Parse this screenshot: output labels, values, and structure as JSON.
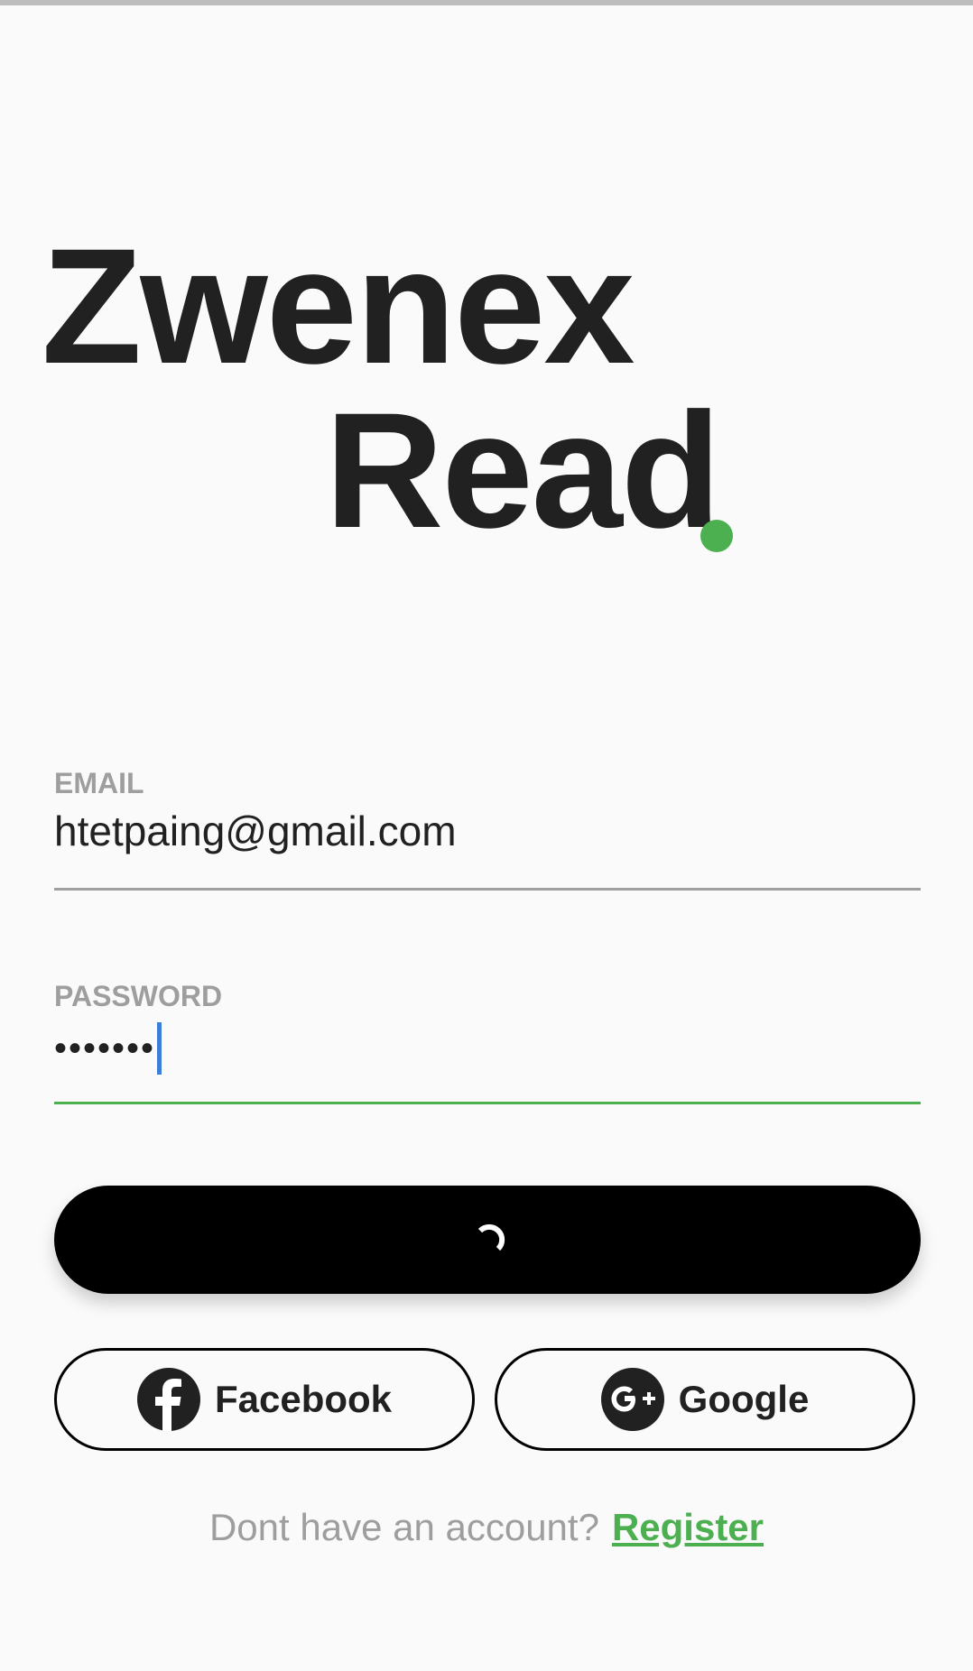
{
  "app": {
    "logo_line1": "Zwenex",
    "logo_line2": "Read",
    "accent_color": "#4caf50"
  },
  "form": {
    "email_label": "EMAIL",
    "email_value": "htetpaing@gmail.com",
    "password_label": "PASSWORD",
    "password_value": "•••••••",
    "email_underline_color": "#9e9e9e",
    "password_underline_color": "#4caf50"
  },
  "login_button": {
    "state": "loading",
    "spinner_icon": "loading-spinner-icon"
  },
  "social": {
    "facebook_label": "Facebook",
    "facebook_icon": "facebook-icon",
    "google_label": "Google",
    "google_icon": "google-plus-icon"
  },
  "footer": {
    "prompt_text": "Dont have an account?",
    "register_label": "Register"
  }
}
